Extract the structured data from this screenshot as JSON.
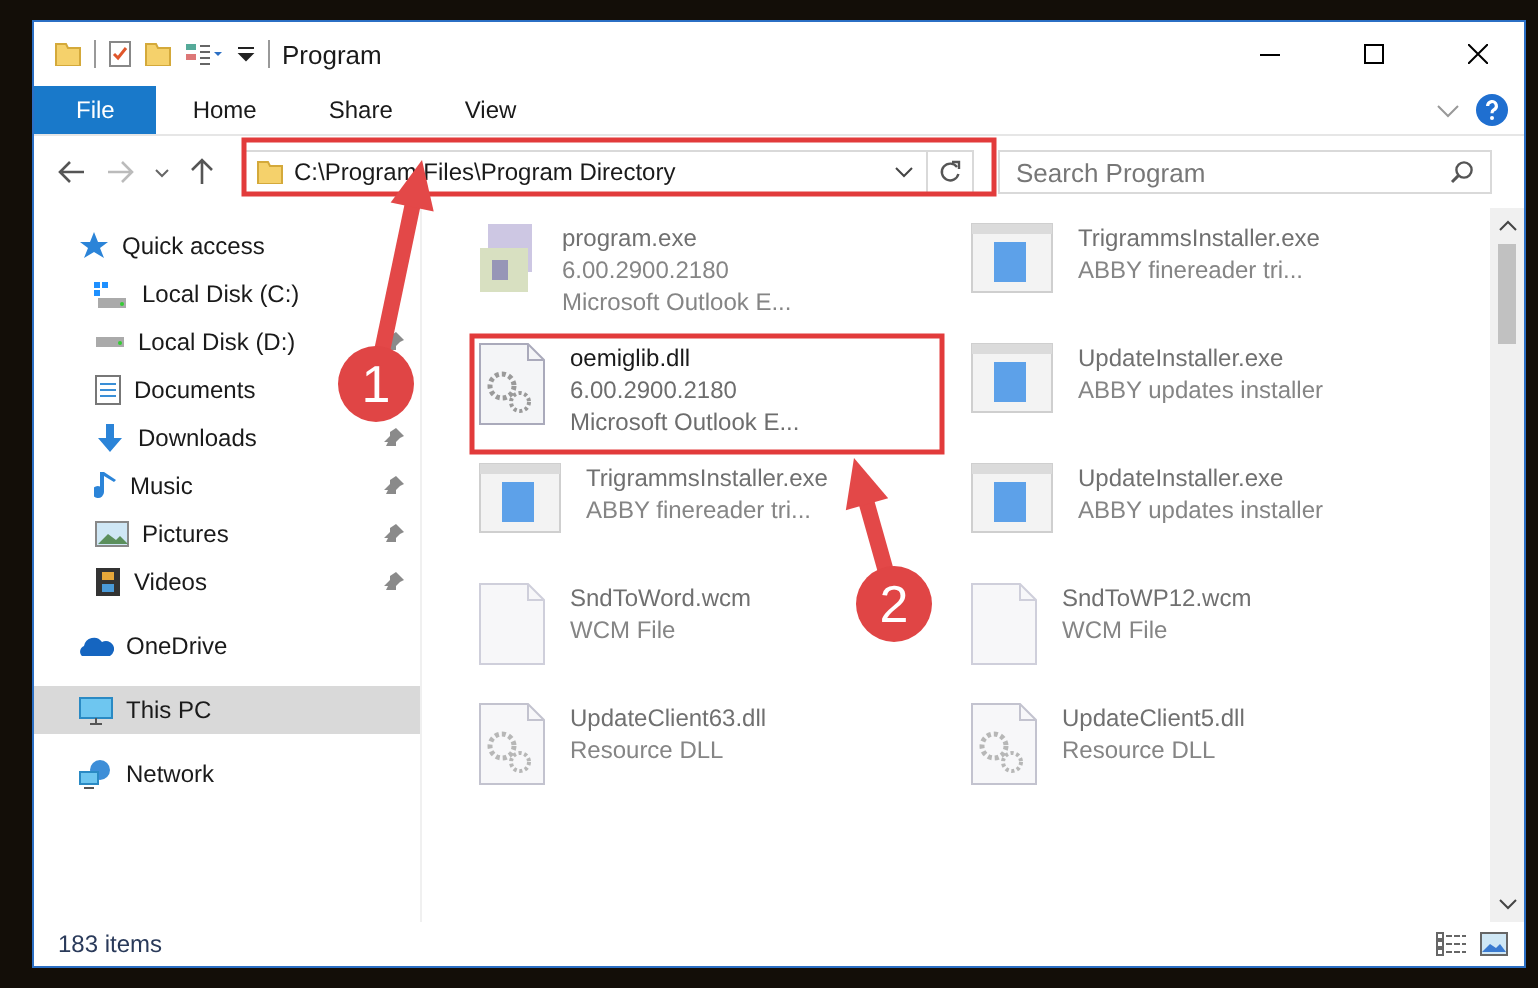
{
  "window": {
    "title": "Program"
  },
  "ribbon_tabs": [
    {
      "label": "File",
      "selected": true
    },
    {
      "label": "Home",
      "selected": false
    },
    {
      "label": "Share",
      "selected": false
    },
    {
      "label": "View",
      "selected": false
    }
  ],
  "address": {
    "path": "C:\\Program Files\\Program Directory"
  },
  "search": {
    "placeholder": "Search Program"
  },
  "sidebar": {
    "items": [
      {
        "label": "Quick access",
        "kind": "star",
        "selected": false,
        "children": [
          {
            "label": "Local Disk (C:)",
            "kind": "drive_c",
            "pinned": false
          },
          {
            "label": "Local Disk (D:)",
            "kind": "drive",
            "pinned": true
          },
          {
            "label": "Documents",
            "kind": "documents",
            "pinned": false
          },
          {
            "label": "Downloads",
            "kind": "downloads",
            "pinned": true
          },
          {
            "label": "Music",
            "kind": "music",
            "pinned": true
          },
          {
            "label": "Pictures",
            "kind": "pictures",
            "pinned": true
          },
          {
            "label": "Videos",
            "kind": "videos",
            "pinned": true
          }
        ]
      },
      {
        "label": "OneDrive",
        "kind": "cloud",
        "selected": false
      },
      {
        "label": "This PC",
        "kind": "pc",
        "selected": true
      },
      {
        "label": "Network",
        "kind": "network",
        "selected": false
      }
    ]
  },
  "files": [
    {
      "name": "program.exe",
      "details": [
        "6.00.2900.2180",
        "Microsoft Outlook E..."
      ],
      "kind": "program",
      "blurred": true
    },
    {
      "name": "TrigrammsInstaller.exe",
      "details": [
        "ABBY finereader tri..."
      ],
      "kind": "installer",
      "blurred": true
    },
    {
      "name": "oemiglib.dll",
      "details": [
        "6.00.2900.2180",
        "Microsoft Outlook E..."
      ],
      "kind": "dll",
      "blurred": false
    },
    {
      "name": "UpdateInstaller.exe",
      "details": [
        "ABBY updates installer"
      ],
      "kind": "installer",
      "blurred": true
    },
    {
      "name": "TrigrammsInstaller.exe",
      "details": [
        "ABBY finereader tri..."
      ],
      "kind": "installer",
      "blurred": true
    },
    {
      "name": "UpdateInstaller.exe",
      "details": [
        "ABBY updates installer"
      ],
      "kind": "installer",
      "blurred": true
    },
    {
      "name": "SndToWord.wcm",
      "details": [
        "WCM File"
      ],
      "kind": "file",
      "blurred": true
    },
    {
      "name": "SndToWP12.wcm",
      "details": [
        "WCM File"
      ],
      "kind": "file",
      "blurred": true
    },
    {
      "name": "UpdateClient63.dll",
      "details": [
        "Resource DLL"
      ],
      "kind": "dll",
      "blurred": true
    },
    {
      "name": "UpdateClient5.dll",
      "details": [
        "Resource DLL"
      ],
      "kind": "dll",
      "blurred": true
    }
  ],
  "status_bar": {
    "count": "183 items"
  },
  "annotations": [
    {
      "number": "1"
    },
    {
      "number": "2"
    }
  ]
}
